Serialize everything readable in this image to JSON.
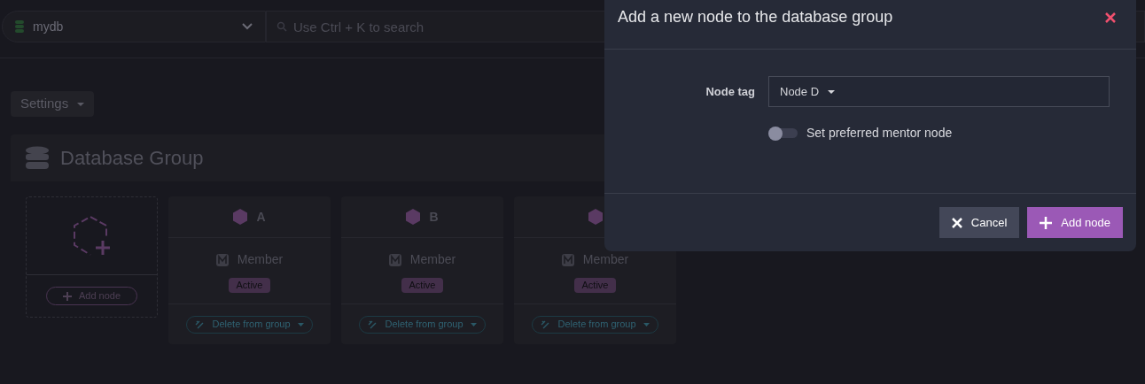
{
  "topbar": {
    "database": "mydb",
    "search": {
      "placeholder": "Use Ctrl + K to search"
    }
  },
  "settings_button": "Settings",
  "panel": {
    "title": "Database Group",
    "add_card": {
      "button": "Add node"
    },
    "nodes": [
      {
        "tag": "A",
        "role": "Member",
        "status": "Active",
        "action": "Delete from group"
      },
      {
        "tag": "B",
        "role": "Member",
        "status": "Active",
        "action": "Delete from group"
      },
      {
        "role": "Member",
        "status": "Active",
        "action": "Delete from group"
      }
    ]
  },
  "dialog": {
    "title": "Add a new node to the database group",
    "field_label": "Node tag",
    "field_value": "Node D",
    "toggle": {
      "label": "Set preferred mentor node",
      "on": false
    },
    "buttons": [
      {
        "kind": "cancel",
        "label": "Cancel"
      },
      {
        "kind": "primary",
        "label": "Add node"
      }
    ]
  }
}
